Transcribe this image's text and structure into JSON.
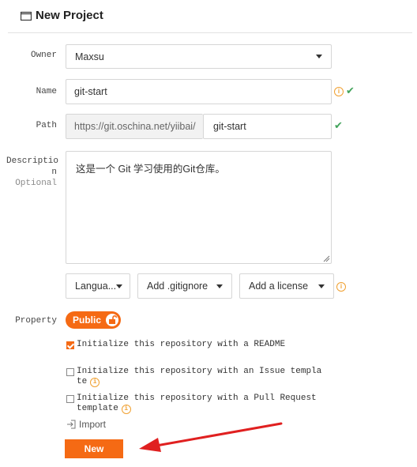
{
  "header": {
    "title": "New Project",
    "icon": "folder-icon"
  },
  "form": {
    "owner": {
      "label": "Owner",
      "value": "Maxsu"
    },
    "name": {
      "label": "Name",
      "value": "git-start"
    },
    "path": {
      "label": "Path",
      "prefix": "https://git.oschina.net/yiibai/",
      "value": "git-start"
    },
    "description": {
      "label_line1": "Descriptio",
      "label_line2": "n",
      "optional": "Optional",
      "value": "这是一个 Git 学习使用的Git仓库。"
    },
    "selects": {
      "language": "Langua...",
      "gitignore": "Add .gitignore",
      "license": "Add a license"
    },
    "property": {
      "label": "Property",
      "visibility": "Public"
    },
    "checkboxes": [
      {
        "line1": "Initialize this repository with a README",
        "line2": "",
        "checked": true
      },
      {
        "line1": "Initialize this repository with an Issue templa",
        "line2": "te",
        "checked": false
      },
      {
        "line1": "Initialize this repository with a Pull Request",
        "line2": "template",
        "checked": false
      }
    ],
    "import_label": "Import",
    "submit_label": "New"
  },
  "colors": {
    "accent": "#f56a14",
    "success": "#41a35a",
    "info": "#f0a030",
    "arrow": "#e02020"
  }
}
